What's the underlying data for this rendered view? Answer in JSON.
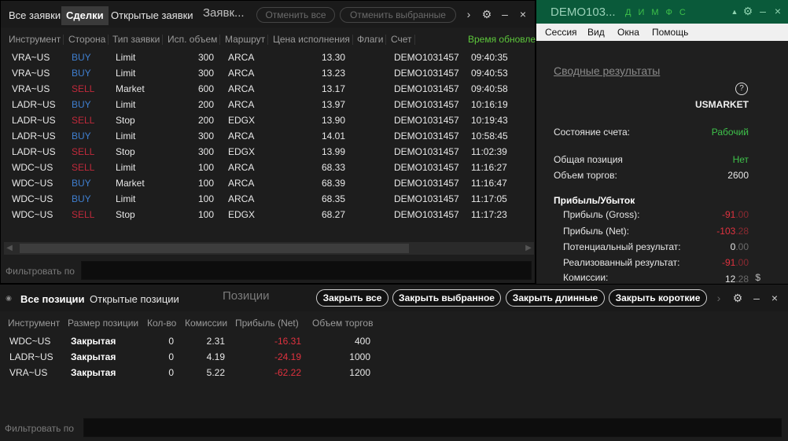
{
  "orders_panel": {
    "tabs": [
      "Все заявки",
      "Сделки",
      "Открытые заявки"
    ],
    "active_tab_index": 1,
    "title": "Заявк...",
    "cancel_all": "Отменить все",
    "cancel_selected": "Отменить выбранные",
    "columns": [
      "Инструмент",
      "Сторона",
      "Тип заявки",
      "Исп. объем",
      "Маршрут",
      "Цена исполнения",
      "Флаги",
      "Счет",
      "Время обновле"
    ],
    "rows": [
      [
        "VRA~US",
        "BUY",
        "Limit",
        "300",
        "ARCA",
        "13.30",
        "DEMO1031457",
        "09:40:35"
      ],
      [
        "VRA~US",
        "BUY",
        "Limit",
        "300",
        "ARCA",
        "13.23",
        "DEMO1031457",
        "09:40:53"
      ],
      [
        "VRA~US",
        "SELL",
        "Market",
        "600",
        "ARCA",
        "13.17",
        "DEMO1031457",
        "09:40:58"
      ],
      [
        "LADR~US",
        "BUY",
        "Limit",
        "200",
        "ARCA",
        "13.97",
        "DEMO1031457",
        "10:16:19"
      ],
      [
        "LADR~US",
        "SELL",
        "Stop",
        "200",
        "EDGX",
        "13.90",
        "DEMO1031457",
        "10:19:43"
      ],
      [
        "LADR~US",
        "BUY",
        "Limit",
        "300",
        "ARCA",
        "14.01",
        "DEMO1031457",
        "10:58:45"
      ],
      [
        "LADR~US",
        "SELL",
        "Stop",
        "300",
        "EDGX",
        "13.99",
        "DEMO1031457",
        "11:02:39"
      ],
      [
        "WDC~US",
        "SELL",
        "Limit",
        "100",
        "ARCA",
        "68.33",
        "DEMO1031457",
        "11:16:27"
      ],
      [
        "WDC~US",
        "BUY",
        "Market",
        "100",
        "ARCA",
        "68.39",
        "DEMO1031457",
        "11:16:47"
      ],
      [
        "WDC~US",
        "BUY",
        "Limit",
        "100",
        "ARCA",
        "68.35",
        "DEMO1031457",
        "11:17:05"
      ],
      [
        "WDC~US",
        "SELL",
        "Stop",
        "100",
        "EDGX",
        "68.27",
        "DEMO1031457",
        "11:17:23"
      ]
    ],
    "filter_label": "Фильтровать по"
  },
  "account_panel": {
    "title": "DEMO103...",
    "mini_tabs": [
      "Д",
      "И",
      "М",
      "Ф",
      "С"
    ],
    "menu": [
      "Сессия",
      "Вид",
      "Окна",
      "Помощь"
    ],
    "summary_link": "Сводные результаты",
    "help_icon": "?",
    "market": "USMARKET",
    "account_state_label": "Состояние счета:",
    "account_state_value": "Рабочий",
    "total_position_label": "Общая позиция",
    "total_position_value": "Нет",
    "volume_label": "Объем торгов:",
    "volume_value": "2600",
    "pnl_header": "Прибыль/Убыток",
    "gross_label": "Прибыль (Gross):",
    "gross_value": "-91",
    "gross_dec": ".00",
    "net_label": "Прибыль (Net):",
    "net_value": "-103",
    "net_dec": ".28",
    "potential_label": "Потенциальный результат:",
    "potential_value": "0",
    "potential_dec": ".00",
    "realized_label": "Реализованный результат:",
    "realized_value": "-91",
    "realized_dec": ".00",
    "commission_label": "Комиссии:",
    "commission_value": "12",
    "commission_dec": ".28",
    "currency": "$",
    "colors": {
      "title_bar": "#0a5a3a",
      "green": "#3ec14a",
      "red": "#e0323f"
    }
  },
  "positions_panel": {
    "tabs": [
      "Все позиции",
      "Открытые позиции"
    ],
    "title": "Позиции",
    "buttons": [
      "Закрыть все",
      "Закрыть выбранное",
      "Закрыть длинные",
      "Закрыть короткие"
    ],
    "columns": [
      "Инструмент",
      "Размер позиции",
      "Кол-во",
      "Комиссии",
      "Прибыль (Net)",
      "Объем торгов"
    ],
    "rows": [
      [
        "WDC~US",
        "Закрытая",
        "0",
        "2.31",
        "-16.31",
        "400"
      ],
      [
        "LADR~US",
        "Закрытая",
        "0",
        "4.19",
        "-24.19",
        "1000"
      ],
      [
        "VRA~US",
        "Закрытая",
        "0",
        "5.22",
        "-62.22",
        "1200"
      ]
    ],
    "filter_label": "Фильтровать по"
  },
  "icons": {
    "next": "›",
    "settings": "⚙",
    "close": "×",
    "minimize": "–",
    "dot": "◉",
    "caret_up": "▲"
  }
}
